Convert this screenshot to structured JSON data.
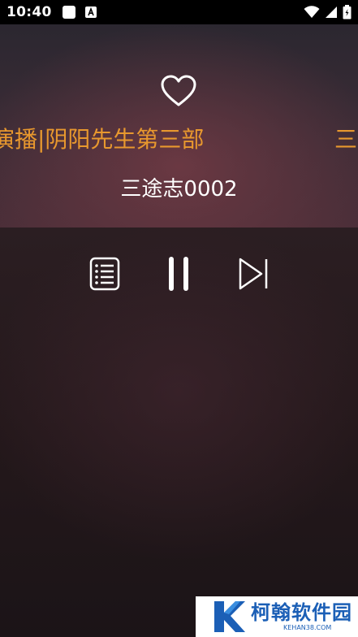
{
  "status_bar": {
    "time": "10:40",
    "icons": [
      "notification-square-icon",
      "font-app-icon",
      "wifi-icon",
      "signal-icon",
      "battery-icon"
    ]
  },
  "player": {
    "album_title": "演播|阴阳先生第三部",
    "album_title_repeat": "三",
    "track_title": "三途志0002",
    "accent_color": "#e8982e",
    "controls": {
      "favorite": "heart-outline-icon",
      "playlist": "playlist-icon",
      "pause": "pause-icon",
      "next": "skip-next-icon"
    }
  },
  "watermark": {
    "brand": "柯翰软件园",
    "domain": "KEHAN38.COM",
    "logo": "k-logo-icon",
    "color": "#1b5fb6"
  }
}
